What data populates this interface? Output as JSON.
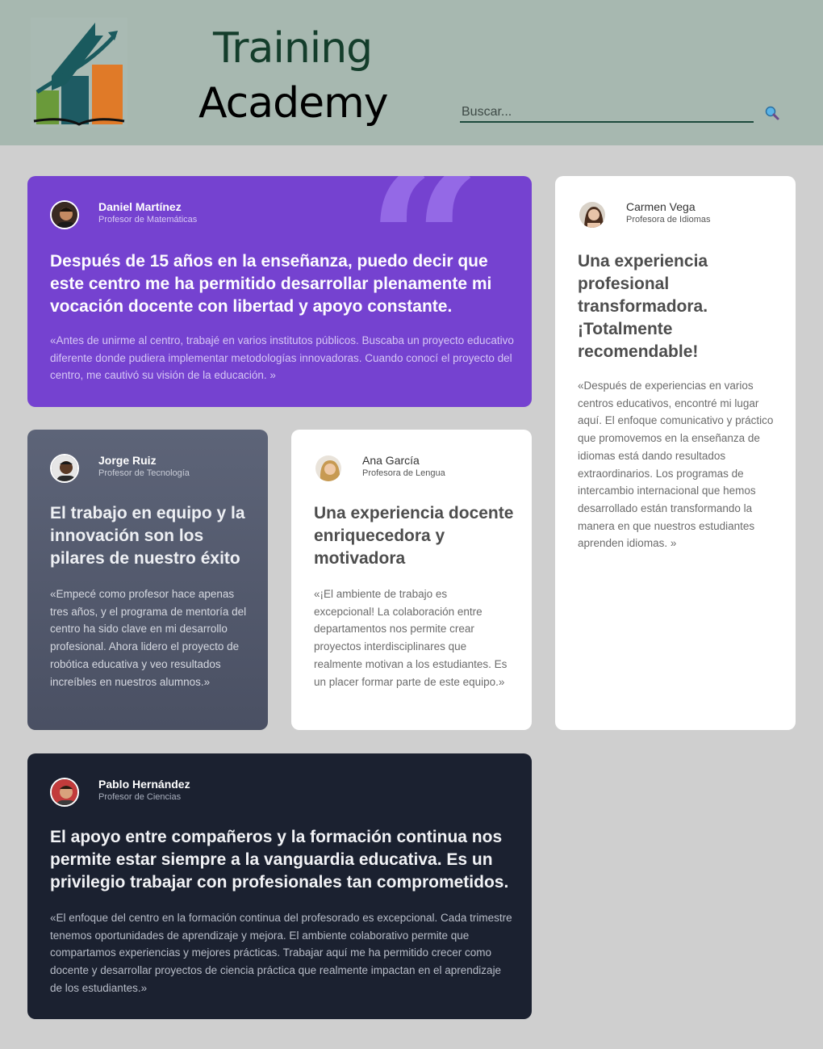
{
  "header": {
    "brand_line1": "Training",
    "brand_line2": "Academy",
    "search_placeholder": "Buscar...",
    "search_icon": "search-icon"
  },
  "colors": {
    "header_bg": "#a7b8b0",
    "page_bg": "#cfcfcf",
    "card_purple": "#7542d0",
    "card_slate": "#4a5063",
    "card_dark": "#1b2130",
    "card_white": "#ffffff"
  },
  "testimonials": [
    {
      "name": "Daniel Martínez",
      "role": "Profesor de Matemáticas",
      "headline": "Después de 15 años en la enseñanza, puedo decir que este centro me ha permitido desarrollar plenamente mi vocación docente con libertad y apoyo constante.",
      "text": "«Antes de unirme al centro, trabajé en varios institutos públicos. Buscaba un proyecto educativo diferente donde pudiera implementar metodologías innovadoras. Cuando conocí el proyecto del centro, me cautivó su visión de la educación. »"
    },
    {
      "name": "Carmen Vega",
      "role": "Profesora de Idiomas",
      "headline": "Una experiencia profesional transformadora. ¡Totalmente recomendable!",
      "text": "«Después de experiencias en varios centros educativos, encontré mi lugar aquí. El enfoque comunicativo y práctico que promovemos en la enseñanza de idiomas está dando resultados extraordinarios. Los programas de intercambio internacional que hemos desarrollado están transformando la manera en que nuestros estudiantes aprenden idiomas. »"
    },
    {
      "name": "Jorge Ruiz",
      "role": "Profesor de Tecnología",
      "headline": "El trabajo en equipo y la innovación son los pilares de nuestro éxito",
      "text": "«Empecé como profesor hace apenas tres años, y el programa de mentoría del centro ha sido clave en mi desarrollo profesional. Ahora lidero el proyecto de robótica educativa y veo resultados increíbles en nuestros alumnos.»"
    },
    {
      "name": "Ana García",
      "role": "Profesora de Lengua",
      "headline": "Una experiencia docente enriquecedora y motivadora",
      "text": "«¡El ambiente de trabajo es excepcional! La colaboración entre departamentos nos permite crear proyectos interdisciplinares que realmente motivan a los estudiantes. Es un placer formar parte de este equipo.»"
    },
    {
      "name": "Pablo Hernández",
      "role": "Profesor de Ciencias",
      "headline": "El apoyo entre compañeros y la formación continua nos permite estar siempre a la vanguardia educativa. Es un privilegio trabajar con profesionales tan comprometidos.",
      "text": "«El enfoque del centro en la formación continua del profesorado es excepcional. Cada trimestre tenemos oportunidades de aprendizaje y mejora. El ambiente colaborativo permite que compartamos experiencias y mejores prácticas. Trabajar aquí me ha permitido crecer como docente y desarrollar proyectos de ciencia práctica que realmente impactan en el aprendizaje de los estudiantes.»"
    }
  ]
}
